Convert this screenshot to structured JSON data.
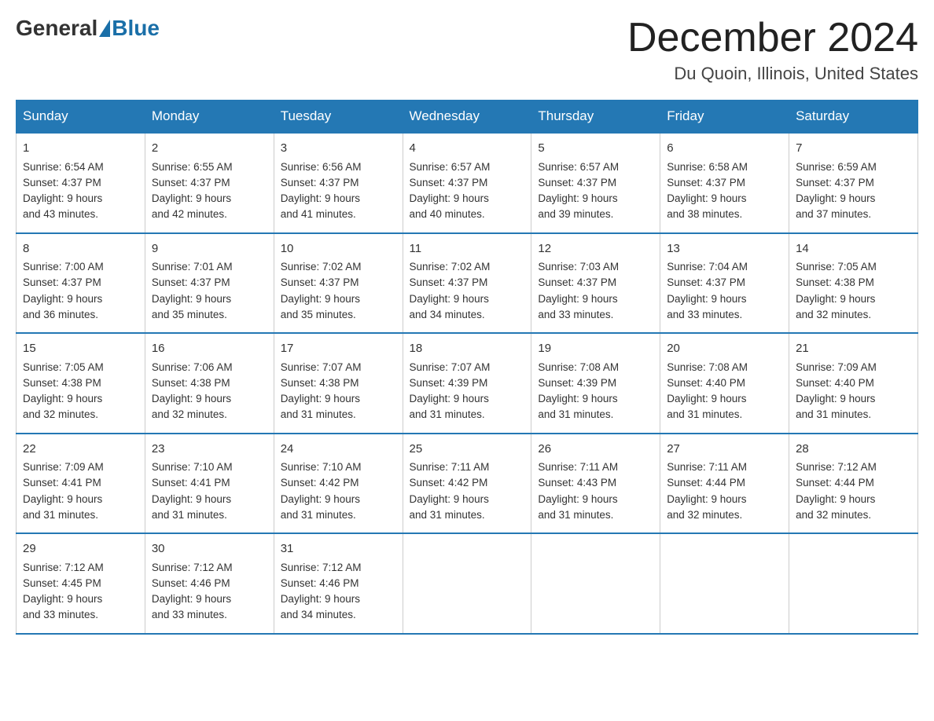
{
  "logo": {
    "text_general": "General",
    "text_blue": "Blue"
  },
  "header": {
    "month_year": "December 2024",
    "location": "Du Quoin, Illinois, United States"
  },
  "days_of_week": [
    "Sunday",
    "Monday",
    "Tuesday",
    "Wednesday",
    "Thursday",
    "Friday",
    "Saturday"
  ],
  "weeks": [
    [
      {
        "day": "1",
        "sunrise": "6:54 AM",
        "sunset": "4:37 PM",
        "daylight": "9 hours and 43 minutes."
      },
      {
        "day": "2",
        "sunrise": "6:55 AM",
        "sunset": "4:37 PM",
        "daylight": "9 hours and 42 minutes."
      },
      {
        "day": "3",
        "sunrise": "6:56 AM",
        "sunset": "4:37 PM",
        "daylight": "9 hours and 41 minutes."
      },
      {
        "day": "4",
        "sunrise": "6:57 AM",
        "sunset": "4:37 PM",
        "daylight": "9 hours and 40 minutes."
      },
      {
        "day": "5",
        "sunrise": "6:57 AM",
        "sunset": "4:37 PM",
        "daylight": "9 hours and 39 minutes."
      },
      {
        "day": "6",
        "sunrise": "6:58 AM",
        "sunset": "4:37 PM",
        "daylight": "9 hours and 38 minutes."
      },
      {
        "day": "7",
        "sunrise": "6:59 AM",
        "sunset": "4:37 PM",
        "daylight": "9 hours and 37 minutes."
      }
    ],
    [
      {
        "day": "8",
        "sunrise": "7:00 AM",
        "sunset": "4:37 PM",
        "daylight": "9 hours and 36 minutes."
      },
      {
        "day": "9",
        "sunrise": "7:01 AM",
        "sunset": "4:37 PM",
        "daylight": "9 hours and 35 minutes."
      },
      {
        "day": "10",
        "sunrise": "7:02 AM",
        "sunset": "4:37 PM",
        "daylight": "9 hours and 35 minutes."
      },
      {
        "day": "11",
        "sunrise": "7:02 AM",
        "sunset": "4:37 PM",
        "daylight": "9 hours and 34 minutes."
      },
      {
        "day": "12",
        "sunrise": "7:03 AM",
        "sunset": "4:37 PM",
        "daylight": "9 hours and 33 minutes."
      },
      {
        "day": "13",
        "sunrise": "7:04 AM",
        "sunset": "4:37 PM",
        "daylight": "9 hours and 33 minutes."
      },
      {
        "day": "14",
        "sunrise": "7:05 AM",
        "sunset": "4:38 PM",
        "daylight": "9 hours and 32 minutes."
      }
    ],
    [
      {
        "day": "15",
        "sunrise": "7:05 AM",
        "sunset": "4:38 PM",
        "daylight": "9 hours and 32 minutes."
      },
      {
        "day": "16",
        "sunrise": "7:06 AM",
        "sunset": "4:38 PM",
        "daylight": "9 hours and 32 minutes."
      },
      {
        "day": "17",
        "sunrise": "7:07 AM",
        "sunset": "4:38 PM",
        "daylight": "9 hours and 31 minutes."
      },
      {
        "day": "18",
        "sunrise": "7:07 AM",
        "sunset": "4:39 PM",
        "daylight": "9 hours and 31 minutes."
      },
      {
        "day": "19",
        "sunrise": "7:08 AM",
        "sunset": "4:39 PM",
        "daylight": "9 hours and 31 minutes."
      },
      {
        "day": "20",
        "sunrise": "7:08 AM",
        "sunset": "4:40 PM",
        "daylight": "9 hours and 31 minutes."
      },
      {
        "day": "21",
        "sunrise": "7:09 AM",
        "sunset": "4:40 PM",
        "daylight": "9 hours and 31 minutes."
      }
    ],
    [
      {
        "day": "22",
        "sunrise": "7:09 AM",
        "sunset": "4:41 PM",
        "daylight": "9 hours and 31 minutes."
      },
      {
        "day": "23",
        "sunrise": "7:10 AM",
        "sunset": "4:41 PM",
        "daylight": "9 hours and 31 minutes."
      },
      {
        "day": "24",
        "sunrise": "7:10 AM",
        "sunset": "4:42 PM",
        "daylight": "9 hours and 31 minutes."
      },
      {
        "day": "25",
        "sunrise": "7:11 AM",
        "sunset": "4:42 PM",
        "daylight": "9 hours and 31 minutes."
      },
      {
        "day": "26",
        "sunrise": "7:11 AM",
        "sunset": "4:43 PM",
        "daylight": "9 hours and 31 minutes."
      },
      {
        "day": "27",
        "sunrise": "7:11 AM",
        "sunset": "4:44 PM",
        "daylight": "9 hours and 32 minutes."
      },
      {
        "day": "28",
        "sunrise": "7:12 AM",
        "sunset": "4:44 PM",
        "daylight": "9 hours and 32 minutes."
      }
    ],
    [
      {
        "day": "29",
        "sunrise": "7:12 AM",
        "sunset": "4:45 PM",
        "daylight": "9 hours and 33 minutes."
      },
      {
        "day": "30",
        "sunrise": "7:12 AM",
        "sunset": "4:46 PM",
        "daylight": "9 hours and 33 minutes."
      },
      {
        "day": "31",
        "sunrise": "7:12 AM",
        "sunset": "4:46 PM",
        "daylight": "9 hours and 34 minutes."
      },
      null,
      null,
      null,
      null
    ]
  ],
  "labels": {
    "sunrise": "Sunrise:",
    "sunset": "Sunset:",
    "daylight": "Daylight:"
  }
}
